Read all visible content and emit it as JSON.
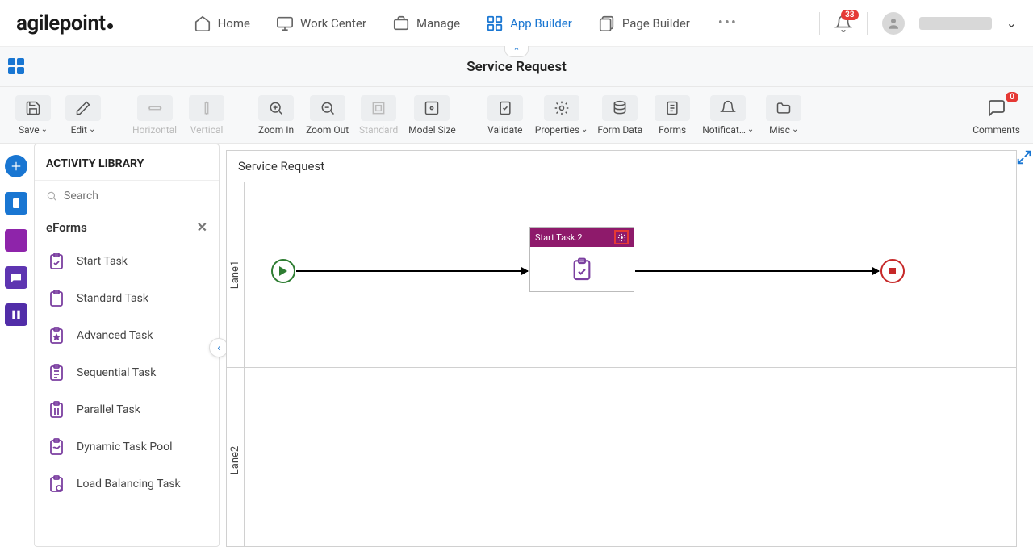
{
  "nav": {
    "logo": "agilepoint",
    "items": [
      {
        "label": "Home"
      },
      {
        "label": "Work Center"
      },
      {
        "label": "Manage"
      },
      {
        "label": "App Builder"
      },
      {
        "label": "Page Builder"
      }
    ],
    "notification_count": "33"
  },
  "title": "Service Request",
  "toolbar": {
    "save": "Save",
    "edit": "Edit",
    "horizontal": "Horizontal",
    "vertical": "Vertical",
    "zoom_in": "Zoom In",
    "zoom_out": "Zoom Out",
    "standard": "Standard",
    "model_size": "Model Size",
    "validate": "Validate",
    "properties": "Properties",
    "form_data": "Form Data",
    "forms": "Forms",
    "notifications": "Notificat…",
    "misc": "Misc",
    "comments": "Comments",
    "comments_count": "0"
  },
  "sidebar": {
    "header": "ACTIVITY LIBRARY",
    "search_placeholder": "Search",
    "group": "eForms",
    "items": [
      "Start Task",
      "Standard Task",
      "Advanced Task",
      "Sequential Task",
      "Parallel Task",
      "Dynamic Task Pool",
      "Load Balancing Task"
    ]
  },
  "canvas": {
    "title": "Service Request",
    "lane1": "Lane1",
    "lane2": "Lane2",
    "task_label": "Start Task.2"
  }
}
